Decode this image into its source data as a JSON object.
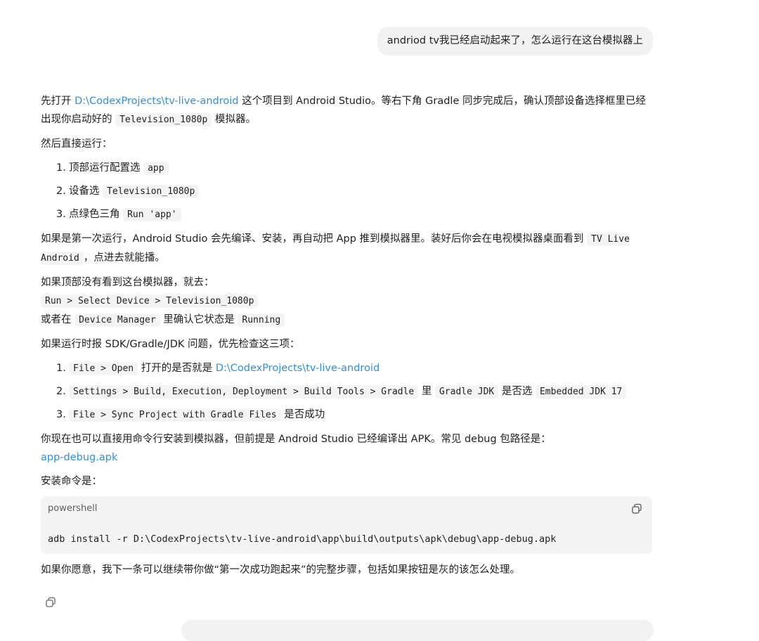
{
  "user_message": "andriod tv我已经启动起来了，怎么运行在这台模拟器上",
  "answer": {
    "p1_a": "先打开 ",
    "project_path": "D:\\CodexProjects\\tv-live-android",
    "p1_b": " 这个项目到 Android Studio。等右下角 Gradle 同步完成后，确认顶部设备选择框里已经出现你启动好的 ",
    "device_name": "Television_1080p",
    "p1_c": " 模拟器。",
    "p2": "然后直接运行：",
    "steps": [
      {
        "num": "1.",
        "text": "顶部运行配置选",
        "code": "app"
      },
      {
        "num": "2.",
        "text": "设备选",
        "code": "Television_1080p"
      },
      {
        "num": "3.",
        "text": "点绿色三角",
        "code": "Run 'app'"
      }
    ],
    "p3_a": "如果是第一次运行，Android Studio 会先编译、安装，再自动把 App 推到模拟器里。装好后你会在电视模拟器桌面看到 ",
    "app_name": "TV Live Android",
    "p3_b": "，点进去就能播。",
    "p4": "如果顶部没有看到这台模拟器，就去：",
    "menu_path": "Run > Select Device > Television_1080p",
    "p5_a": "或者在 ",
    "device_manager": "Device Manager",
    "p5_b": " 里确认它状态是 ",
    "running": "Running",
    "p6": "如果运行时报 SDK/Gradle/JDK 问题，优先检查这三项：",
    "checks": [
      {
        "num": "1.",
        "code": "File > Open",
        "text": "打开的是否就是",
        "link": "D:\\CodexProjects\\tv-live-android"
      },
      {
        "num": "2.",
        "code": "Settings > Build, Execution, Deployment > Build Tools > Gradle",
        "text": "里",
        "code2": "Gradle JDK",
        "text2": "是否选",
        "code3": "Embedded JDK 17"
      },
      {
        "num": "3.",
        "code": "File > Sync Project with Gradle Files",
        "text": "是否成功"
      }
    ],
    "p7": "你现在也可以直接用命令行安装到模拟器，但前提是 Android Studio 已经编译出 APK。常见 debug 包路径是：",
    "apk_link": "app-debug.apk",
    "p8": "安装命令是：",
    "codeblock": {
      "lang": "powershell",
      "command": "adb install -r D:\\CodexProjects\\tv-live-android\\app\\build\\outputs\\apk\\debug\\app-debug.apk"
    },
    "p9": "如果你愿意，我下一条可以继续带你做“第一次成功跑起来”的完整步骤，包括如果按钮是灰的该怎么处理。"
  },
  "icons": {
    "code_copy": "copy-icon",
    "message_copy": "copy-icon"
  }
}
